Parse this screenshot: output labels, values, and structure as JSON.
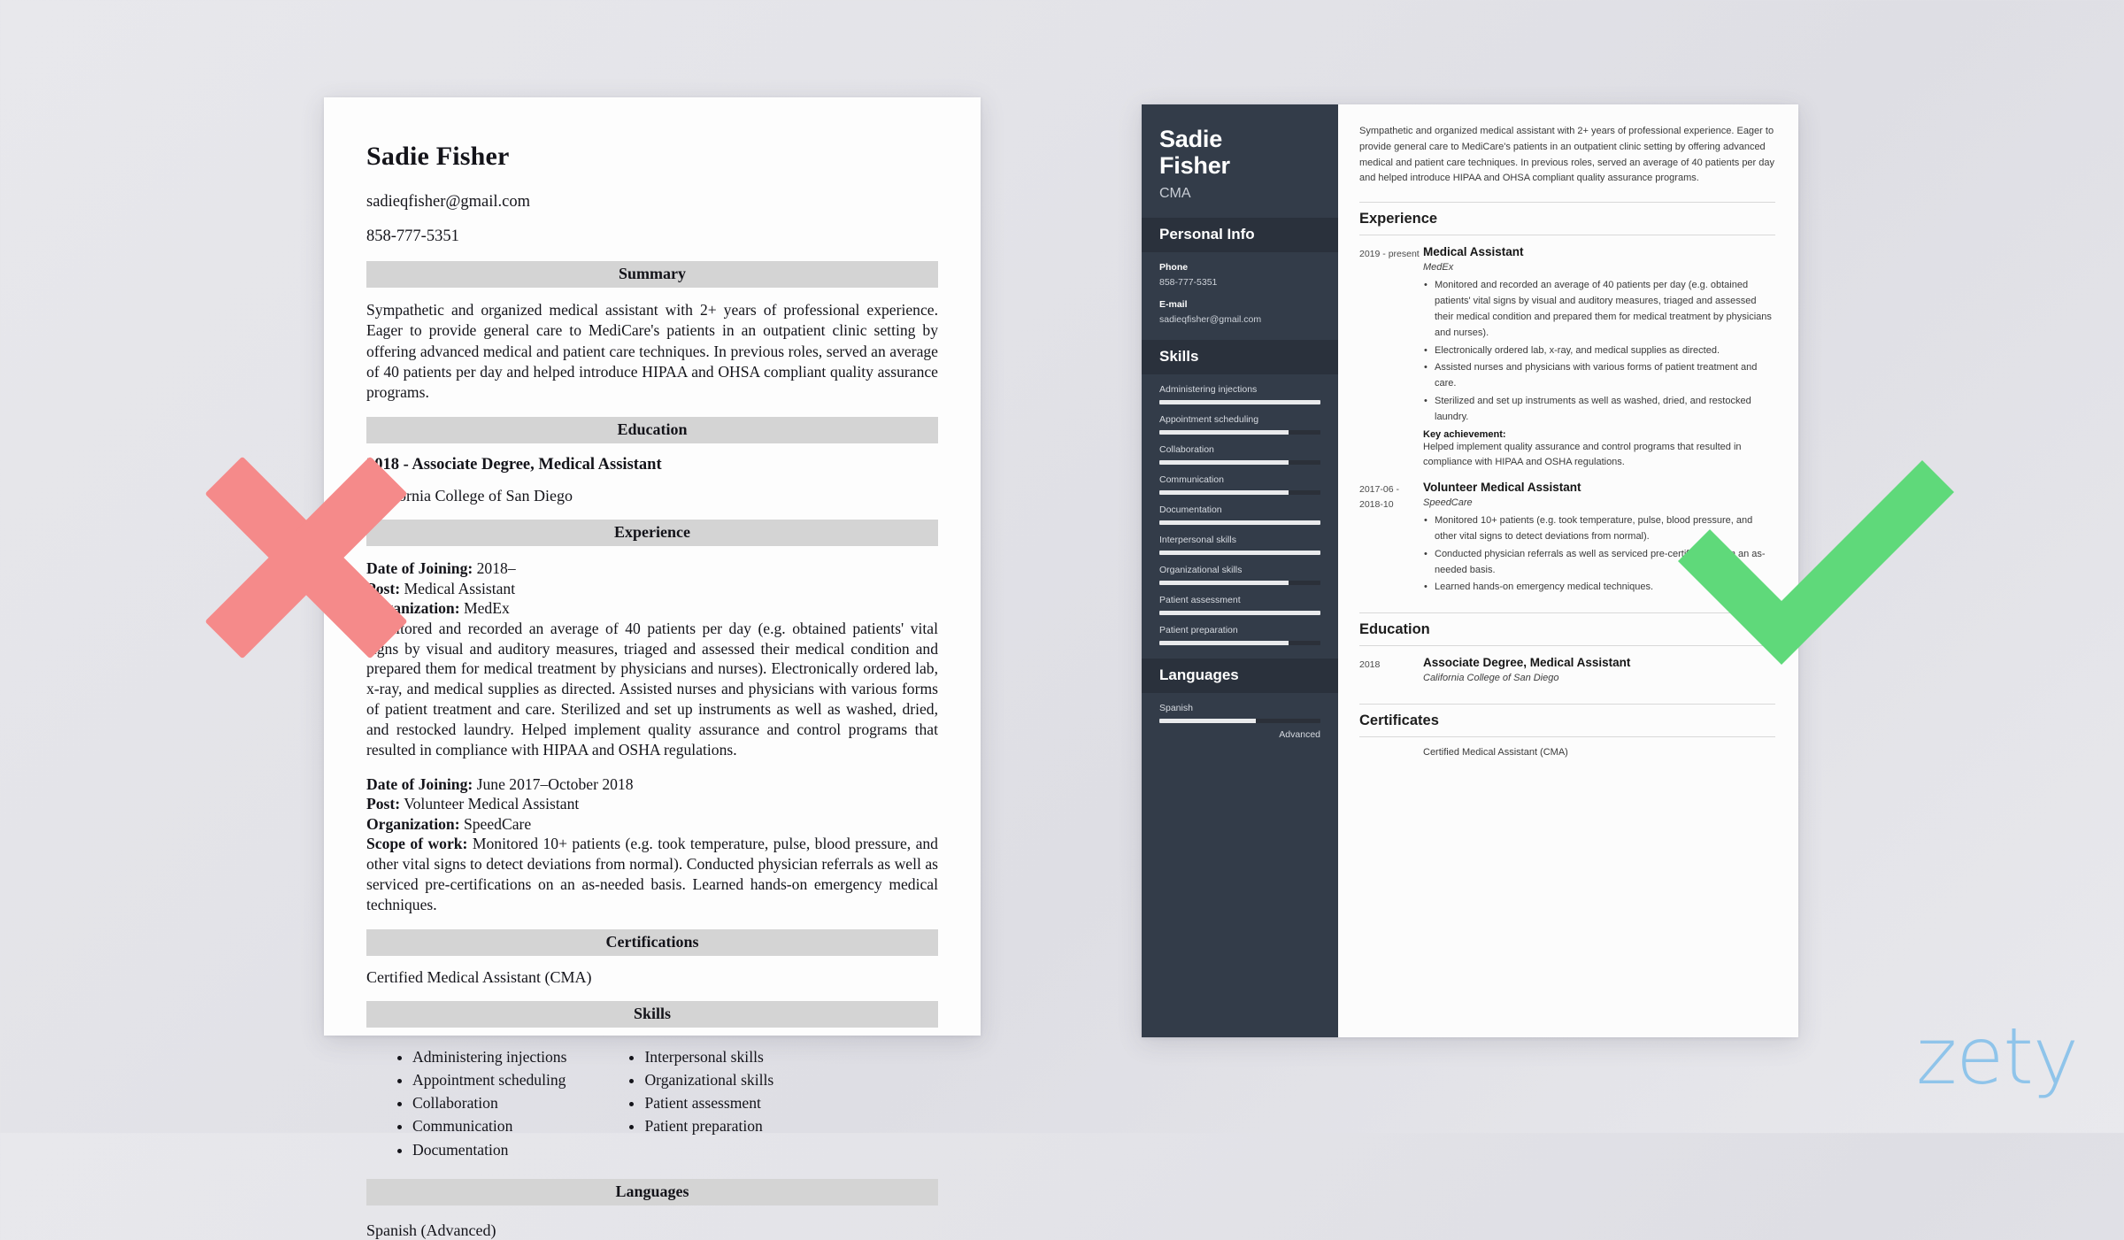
{
  "colors": {
    "background": "#e6e6eb",
    "sidebar_dark": "#333c49",
    "sidebar_header": "#2a313c",
    "x_mark": "#f58a8a",
    "check_mark": "#5fd97a",
    "logo": "#8fc4ea",
    "section_bar": "#d4d4d4"
  },
  "bad_resume": {
    "name": "Sadie Fisher",
    "email": "sadieqfisher@gmail.com",
    "phone": "858-777-5351",
    "sections": {
      "summary_heading": "Summary",
      "summary_text": "Sympathetic and organized medical assistant with 2+ years of professional experience. Eager to provide general care to MediCare's patients in an outpatient clinic setting by offering advanced medical and patient care techniques. In previous roles, served an average of 40 patients per day and helped introduce HIPAA and OHSA compliant quality assurance programs.",
      "education_heading": "Education",
      "education_degree": "2018 - Associate Degree, Medical Assistant",
      "education_school": "California College of San Diego",
      "experience_heading": "Experience",
      "certifications_heading": "Certifications",
      "certifications_text": "Certified Medical Assistant (CMA)",
      "skills_heading": "Skills",
      "languages_heading": "Languages",
      "languages_text": "Spanish (Advanced)"
    },
    "jobs": [
      {
        "date_label": "Date of Joining:",
        "date_value": "2018–",
        "post_label": "Post:",
        "post_value": "Medical Assistant",
        "org_label": "Organization:",
        "org_value": "MedEx",
        "blurb": "Monitored and recorded an average of 40 patients per day (e.g. obtained patients' vital signs by visual and auditory measures, triaged and assessed their medical condition and prepared them for medical treatment by physicians and nurses). Electronically ordered lab, x-ray, and medical supplies as directed. Assisted nurses and physicians with various forms of patient treatment and care. Sterilized and set up instruments as well as washed, dried, and restocked laundry. Helped implement quality assurance and control programs that resulted in compliance with HIPAA and OSHA regulations."
      },
      {
        "date_label": "Date of Joining:",
        "date_value": "June 2017–October 2018",
        "post_label": "Post:",
        "post_value": "Volunteer Medical Assistant",
        "org_label": "Organization:",
        "org_value": "SpeedCare",
        "scope_label": "Scope of work:",
        "blurb": "Monitored 10+ patients (e.g. took temperature, pulse, blood pressure, and other vital signs to detect deviations from normal). Conducted physician referrals as well as serviced pre-certifications on an as-needed basis. Learned hands-on emergency medical techniques."
      }
    ],
    "skills_col1": [
      "Administering injections",
      "Appointment scheduling",
      "Collaboration",
      "Communication",
      "Documentation"
    ],
    "skills_col2": [
      "Interpersonal skills",
      "Organizational skills",
      "Patient assessment",
      "Patient preparation"
    ]
  },
  "good_resume": {
    "sidebar": {
      "first_name": "Sadie",
      "last_name": "Fisher",
      "job_title": "CMA",
      "personal_info_heading": "Personal Info",
      "phone_label": "Phone",
      "phone_value": "858-777-5351",
      "email_label": "E-mail",
      "email_value": "sadieqfisher@gmail.com",
      "skills_heading": "Skills",
      "skills": [
        {
          "name": "Administering injections",
          "level": 100
        },
        {
          "name": "Appointment scheduling",
          "level": 80
        },
        {
          "name": "Collaboration",
          "level": 80
        },
        {
          "name": "Communication",
          "level": 80
        },
        {
          "name": "Documentation",
          "level": 100
        },
        {
          "name": "Interpersonal skills",
          "level": 100
        },
        {
          "name": "Organizational skills",
          "level": 80
        },
        {
          "name": "Patient assessment",
          "level": 100
        },
        {
          "name": "Patient preparation",
          "level": 80
        }
      ],
      "languages_heading": "Languages",
      "language_name": "Spanish",
      "language_level": 60,
      "language_level_label": "Advanced"
    },
    "main": {
      "summary": "Sympathetic and organized medical assistant with 2+ years of professional experience. Eager to provide general care to MediCare's patients in an outpatient clinic setting by offering advanced medical and patient care techniques. In previous roles, served an average of 40 patients per day and helped introduce HIPAA and OHSA compliant quality assurance programs.",
      "experience_heading": "Experience",
      "jobs": [
        {
          "date": "2019 - present",
          "role": "Medical Assistant",
          "org": "MedEx",
          "bullets": [
            "Monitored and recorded an average of 40 patients per day (e.g. obtained patients' vital signs by visual and auditory measures, triaged and assessed their medical condition and prepared them for medical treatment by physicians and nurses).",
            "Electronically ordered lab, x-ray, and medical supplies as directed.",
            "Assisted nurses and physicians with various forms of patient treatment and care.",
            "Sterilized and set up instruments as well as washed, dried, and restocked laundry."
          ],
          "key_achievement_label": "Key achievement:",
          "key_achievement_text": "Helped implement quality assurance and control programs that resulted in compliance with HIPAA and OSHA regulations."
        },
        {
          "date": "2017-06 - 2018-10",
          "role": "Volunteer Medical Assistant",
          "org": "SpeedCare",
          "bullets": [
            "Monitored 10+ patients (e.g. took temperature, pulse, blood pressure, and other vital signs to detect deviations from normal).",
            "Conducted physician referrals as well as serviced pre-certifications on an as-needed basis.",
            "Learned hands-on emergency medical techniques."
          ]
        }
      ],
      "education_heading": "Education",
      "education": {
        "date": "2018",
        "degree": "Associate Degree, Medical Assistant",
        "school": "California College of San Diego"
      },
      "certificates_heading": "Certificates",
      "certificate": "Certified Medical Assistant (CMA)"
    }
  },
  "marks": {
    "x_label": "rejected",
    "check_label": "approved"
  },
  "logo": {
    "text": "zety"
  }
}
